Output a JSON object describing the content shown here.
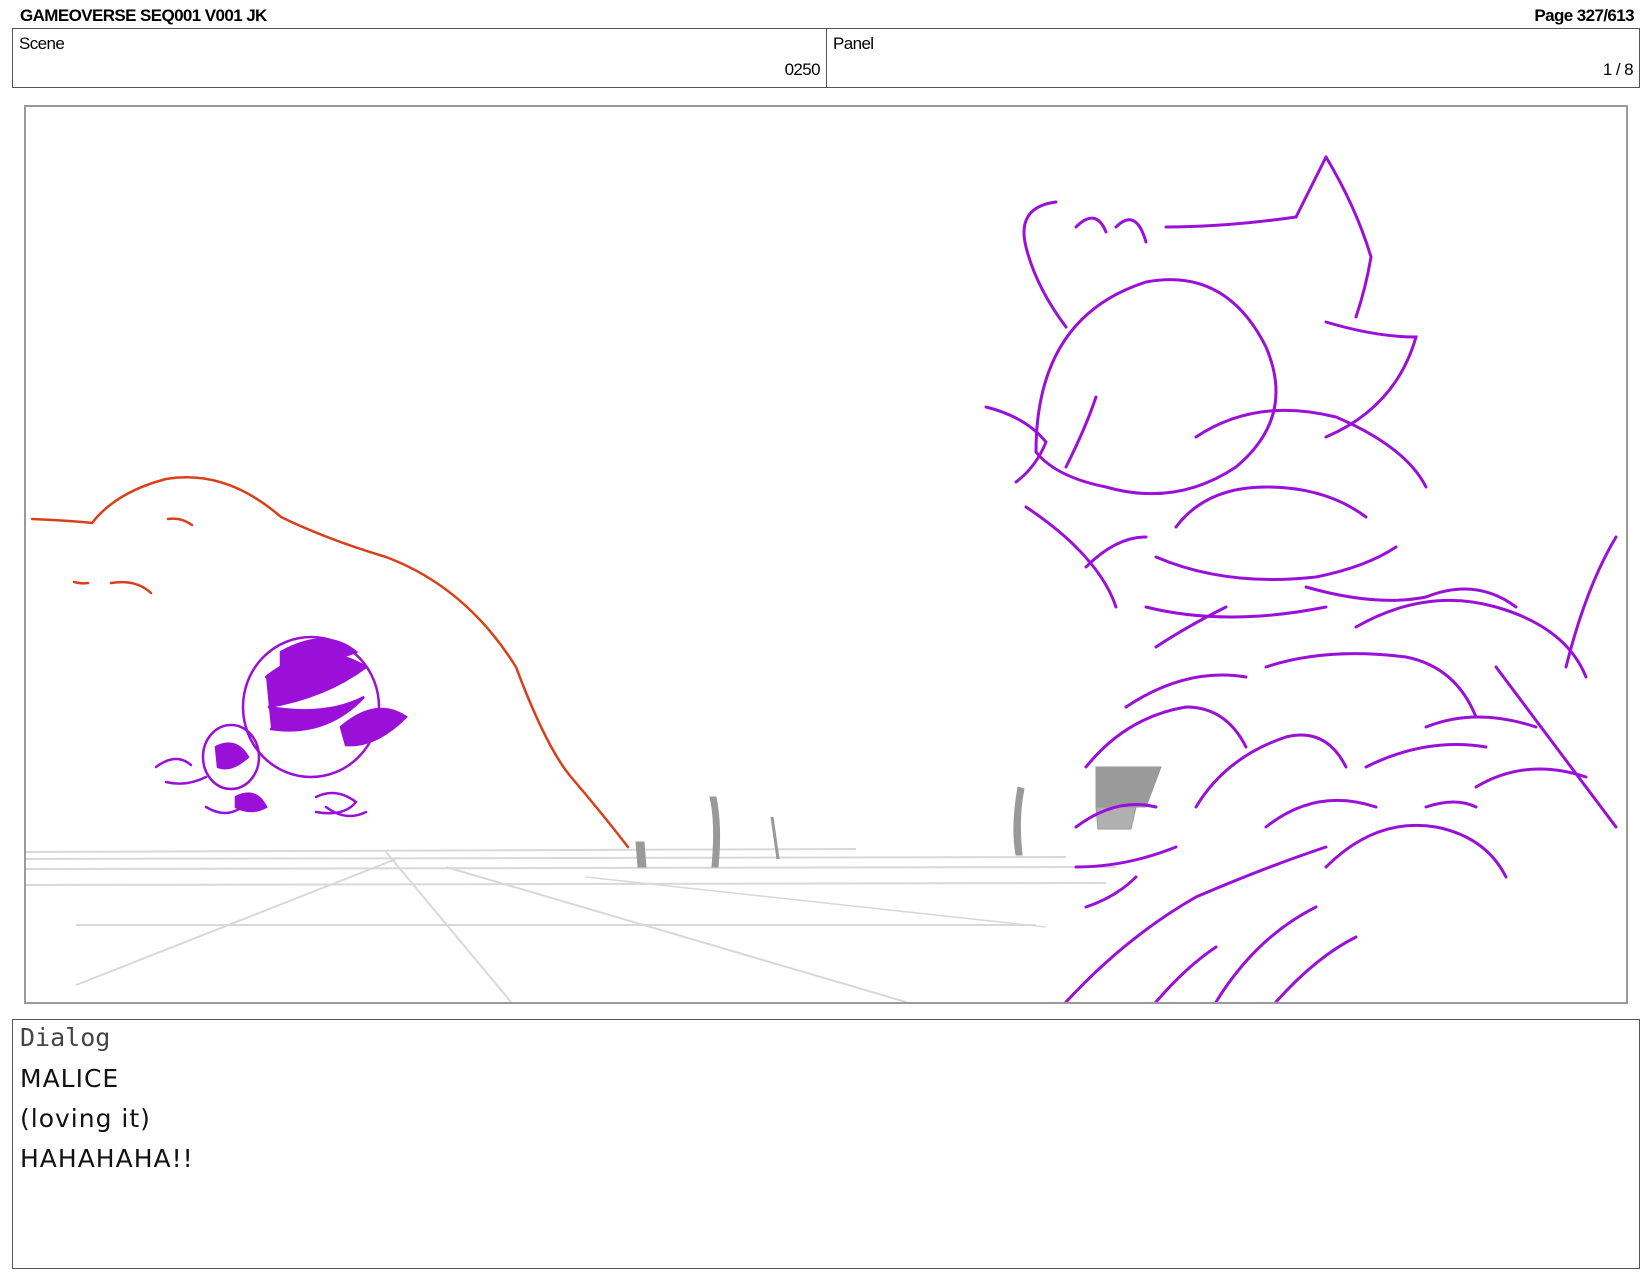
{
  "header": {
    "project": "GAMEOVERSE SEQ001 V001 JK",
    "page": "Page 327/613"
  },
  "info": {
    "scene_label": "Scene",
    "scene_value": "0250",
    "panel_label": "Panel",
    "panel_value": "1 / 8"
  },
  "dialog": {
    "label": "Dialog",
    "lines": [
      "MALICE",
      "(loving it)",
      "HAHAHAHA!!"
    ]
  },
  "colors": {
    "character_purple": "#9b10d8",
    "hill_line": "#d9401a",
    "guide_gray": "#d8d8d8",
    "frame_border": "#9a9a9a"
  }
}
